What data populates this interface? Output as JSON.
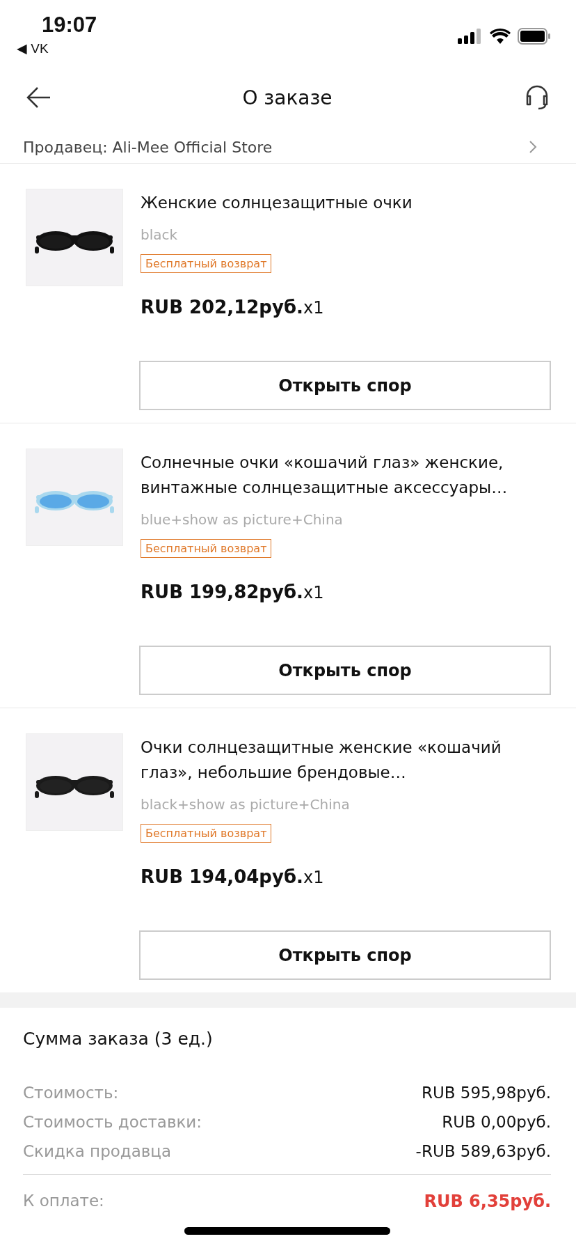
{
  "status_bar": {
    "time": "19:07",
    "back_app": "◀ VK"
  },
  "header": {
    "title": "О заказе"
  },
  "seller": {
    "text": "Продавец: Ali-Mee Official Store"
  },
  "items": [
    {
      "title": "Женские солнцезащитные очки",
      "variant": "black",
      "tag": "Бесплатный возврат",
      "price": "RUB 202,12руб.",
      "quantity": "x1",
      "button": "Открыть спор"
    },
    {
      "title": "Солнечные очки «кошачий глаз» женские, винтажные солнцезащитные аксессуары…",
      "variant": "blue+show as picture+China",
      "tag": "Бесплатный возврат",
      "price": "RUB 199,82руб.",
      "quantity": "x1",
      "button": "Открыть спор"
    },
    {
      "title": "Очки солнцезащитные женские «кошачий глаз», небольшие брендовые…",
      "variant": "black+show as picture+China",
      "tag": "Бесплатный возврат",
      "price": "RUB 194,04руб.",
      "quantity": "x1",
      "button": "Открыть спор"
    }
  ],
  "summary": {
    "title": "Сумма заказа (3 ед.)",
    "rows": [
      {
        "label": "Стоимость:",
        "value": "RUB 595,98руб."
      },
      {
        "label": "Стоимость доставки:",
        "value": "RUB 0,00руб."
      },
      {
        "label": "Скидка продавца",
        "value": "-RUB 589,63руб."
      }
    ],
    "total": {
      "label": "К оплате:",
      "value": "RUB 6,35руб."
    }
  }
}
